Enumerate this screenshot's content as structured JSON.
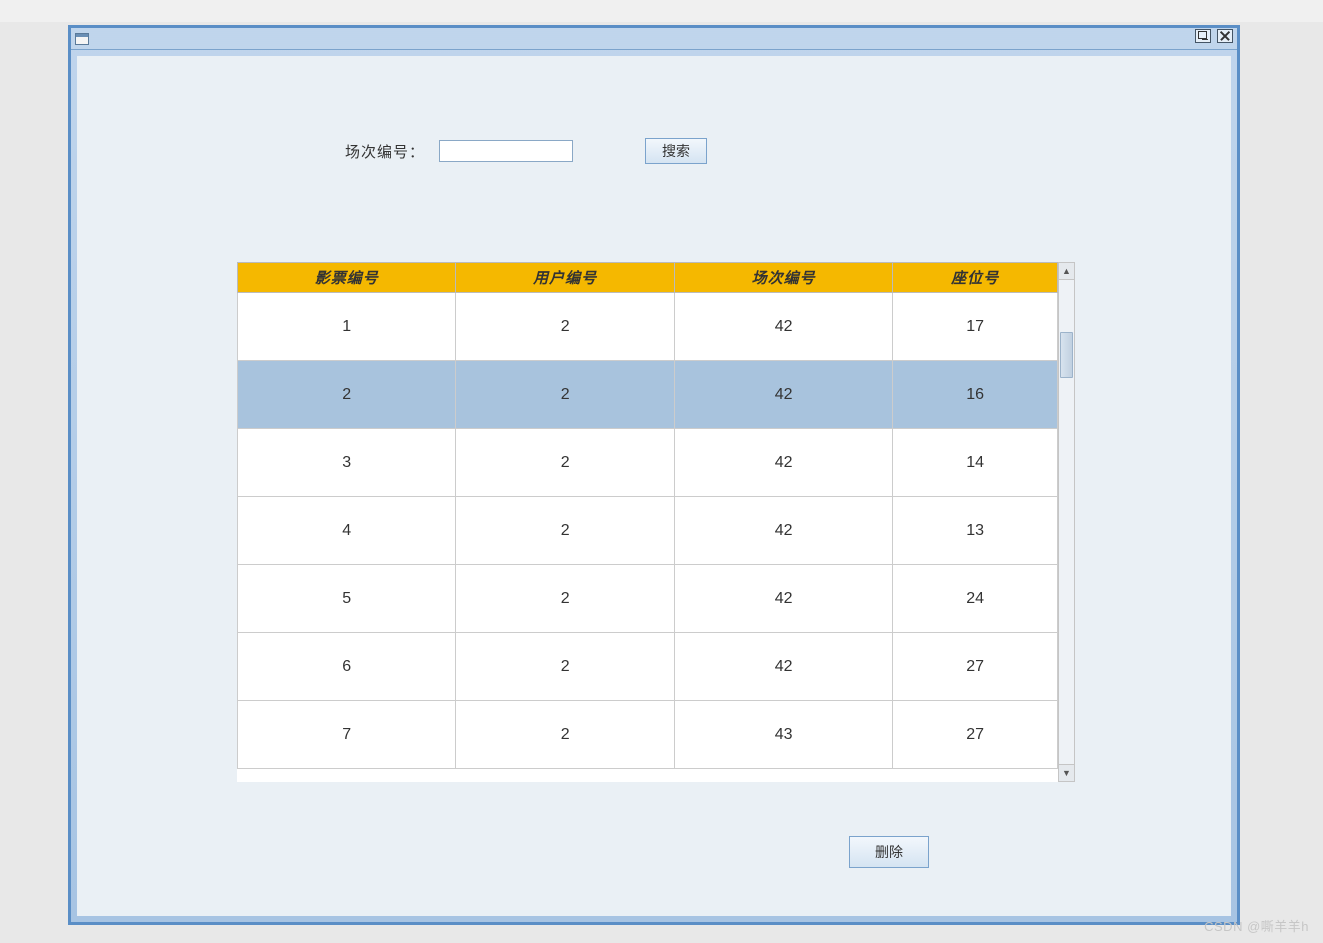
{
  "titlebar": {
    "icon_name": "window-icon",
    "restore_name": "restore-icon",
    "close_name": "close-icon"
  },
  "search": {
    "label": "场次编号：",
    "value": "",
    "button_label": "搜索"
  },
  "table": {
    "headers": [
      "影票编号",
      "用户编号",
      "场次编号",
      "座位号"
    ],
    "rows": [
      {
        "cells": [
          "1",
          "2",
          "42",
          "17"
        ],
        "selected": false
      },
      {
        "cells": [
          "2",
          "2",
          "42",
          "16"
        ],
        "selected": true
      },
      {
        "cells": [
          "3",
          "2",
          "42",
          "14"
        ],
        "selected": false
      },
      {
        "cells": [
          "4",
          "2",
          "42",
          "13"
        ],
        "selected": false
      },
      {
        "cells": [
          "5",
          "2",
          "42",
          "24"
        ],
        "selected": false
      },
      {
        "cells": [
          "6",
          "2",
          "42",
          "27"
        ],
        "selected": false
      },
      {
        "cells": [
          "7",
          "2",
          "43",
          "27"
        ],
        "selected": false
      }
    ]
  },
  "actions": {
    "delete_label": "删除"
  },
  "watermark": "CSDN @嘶羊羊h"
}
